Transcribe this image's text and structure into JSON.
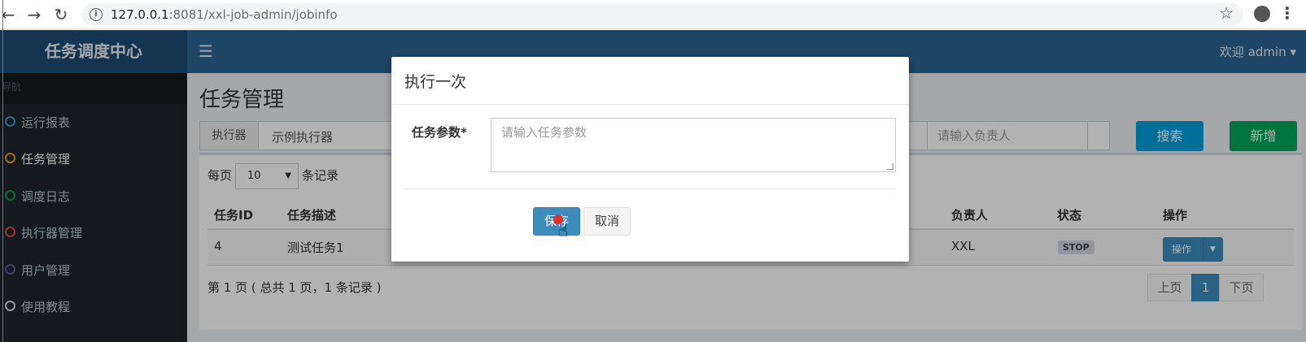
{
  "browser": {
    "url_host": "127.0.0.1",
    "url_rest": ":8081/xxl-job-admin/jobinfo",
    "info_icon": "i"
  },
  "header": {
    "logo": "任务调度中心",
    "user": "欢迎 admin ▾"
  },
  "sidebar": {
    "header": "导航",
    "items": [
      {
        "label": "运行报表",
        "color": "#3c9ad6"
      },
      {
        "label": "任务管理",
        "color": "#f39c12"
      },
      {
        "label": "调度日志",
        "color": "#00a65a"
      },
      {
        "label": "执行器管理",
        "color": "#dd4b39"
      },
      {
        "label": "用户管理",
        "color": "#605ca8"
      },
      {
        "label": "使用教程",
        "color": "#d2d6de"
      }
    ]
  },
  "main": {
    "title": "任务管理",
    "filter": {
      "executor_label": "执行器",
      "executor_value": "示例执行器",
      "owner_placeholder": "请输入负责人",
      "search_button": "搜索",
      "add_button": "新增"
    },
    "perpage": {
      "prefix": "每页",
      "value": "10",
      "suffix": "条记录"
    },
    "table": {
      "headers": [
        "任务ID",
        "任务描述",
        "负责人",
        "状态",
        "操作"
      ],
      "rows": [
        {
          "id": "4",
          "desc": "测试任务1",
          "owner": "XXL",
          "status": "STOP",
          "op": "操作"
        }
      ]
    },
    "paging_info": "第 1 页 ( 总共 1 页，1 条记录 )",
    "pager": {
      "prev": "上页",
      "current": "1",
      "next": "下页"
    }
  },
  "modal": {
    "title": "执行一次",
    "param_label": "任务参数*",
    "param_placeholder": "请输入任务参数",
    "save_button": "保存",
    "cancel_button": "取消"
  }
}
